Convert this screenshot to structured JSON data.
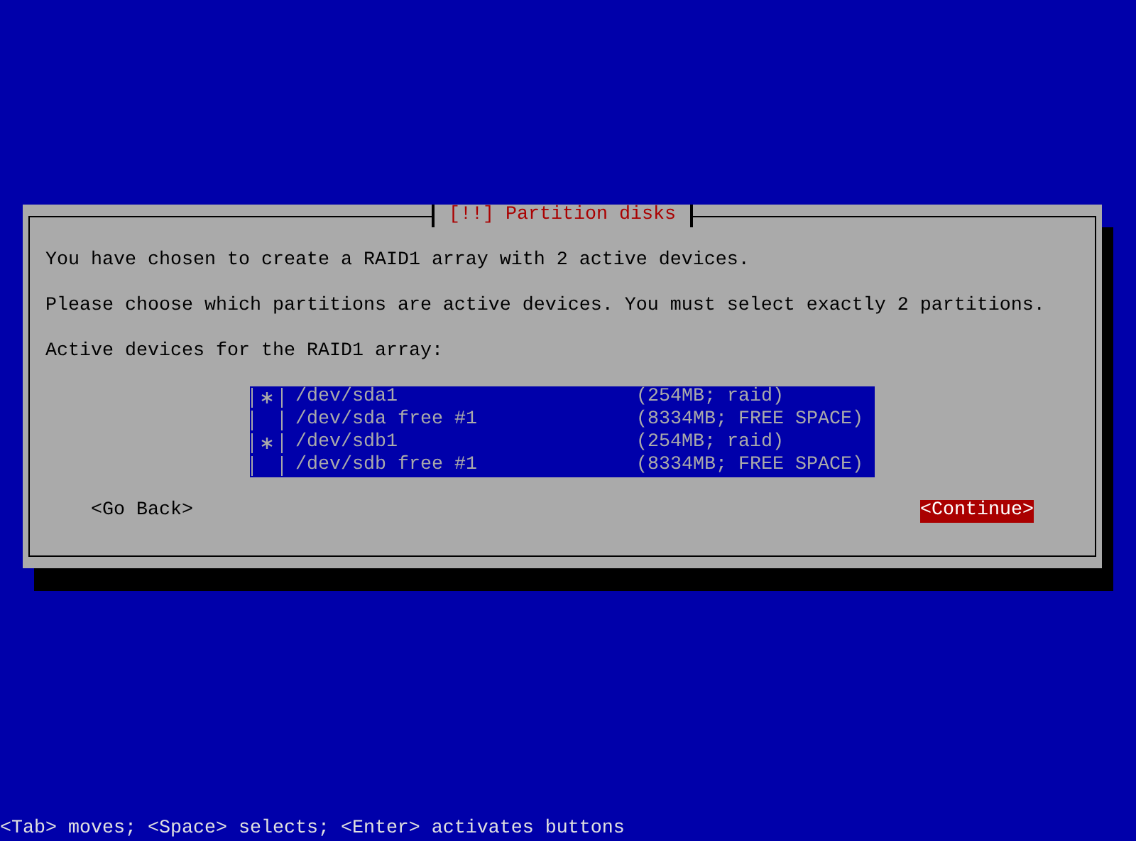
{
  "dialog": {
    "title": "[!!] Partition disks",
    "paragraphs": [
      "You have chosen to create a RAID1 array with 2 active devices.",
      "Please choose which partitions are active devices. You must select exactly 2 partitions."
    ],
    "list_label": "Active devices for the RAID1 array:",
    "devices": [
      {
        "name": "/dev/sda1",
        "size": "(254MB; raid)",
        "checked": true
      },
      {
        "name": "/dev/sda free #1",
        "size": "(8334MB; FREE SPACE)",
        "checked": false
      },
      {
        "name": "/dev/sdb1",
        "size": "(254MB; raid)",
        "checked": true
      },
      {
        "name": "/dev/sdb free #1",
        "size": "(8334MB; FREE SPACE)",
        "checked": false
      }
    ],
    "buttons": [
      {
        "label": "<Go Back>",
        "selected": false
      },
      {
        "label": "<Continue>",
        "selected": true
      }
    ]
  },
  "status_bar": "<Tab> moves; <Space> selects; <Enter> activates buttons"
}
